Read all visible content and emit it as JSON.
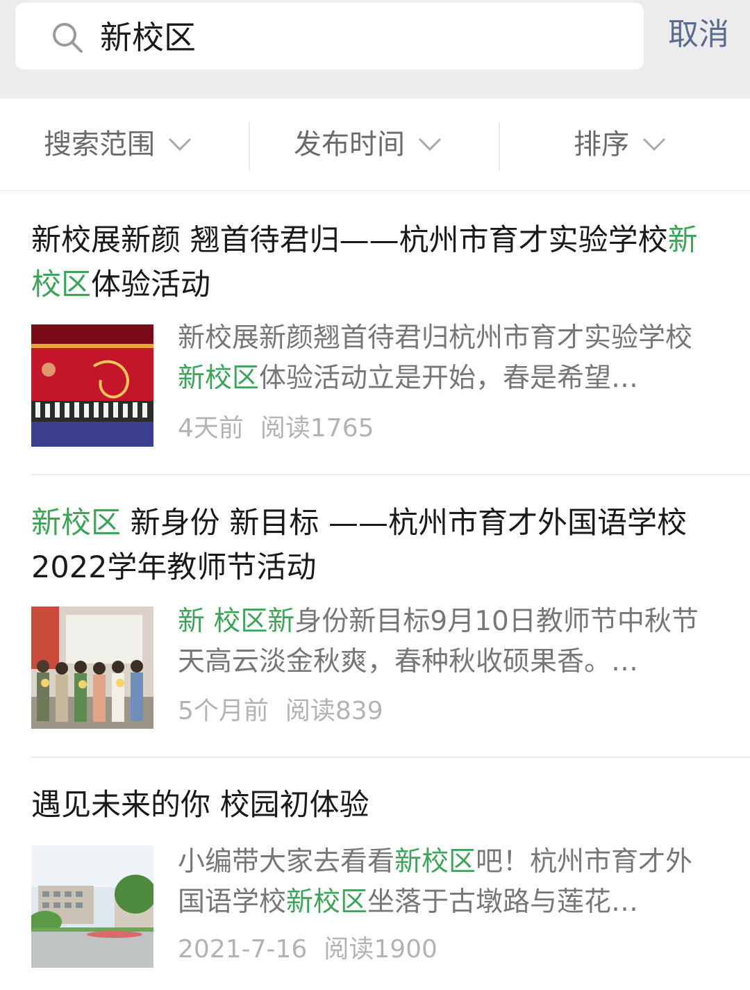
{
  "search": {
    "query": "新校区",
    "cancel_label": "取消"
  },
  "filters": [
    {
      "label": "搜索范围"
    },
    {
      "label": "发布时间"
    },
    {
      "label": "排序"
    }
  ],
  "results": [
    {
      "title_pre": "新校展新颜 翘首待君归——杭州市育才实验学校",
      "title_hl": "新校区",
      "title_post": "体验活动",
      "summary_pre": "新校展新颜翘首待君归杭州市育才实验学校",
      "summary_hl": "新校区",
      "summary_post": "体验活动立是开始，春是希望…",
      "time": "4天前",
      "reads": "阅读1765"
    },
    {
      "title_hl": "新校区",
      "title_post": " 新身份 新目标 ——杭州市育才外国语学校2022学年教师节活动",
      "summary_hl": "新 校区新",
      "summary_post": "身份新目标9月10日教师节中秋节天高云淡金秋爽，春种秋收硕果香。…",
      "time": "5个月前",
      "reads": "阅读839"
    },
    {
      "title": "遇见未来的你 校园初体验",
      "summary_a": "小编带大家去看看",
      "summary_hl1": "新校区",
      "summary_b": "吧！杭州市育才外国语学校",
      "summary_hl2": "新校区",
      "summary_c": "坐落于古墩路与莲花…",
      "time": "2021-7-16",
      "reads": "阅读1900"
    }
  ]
}
